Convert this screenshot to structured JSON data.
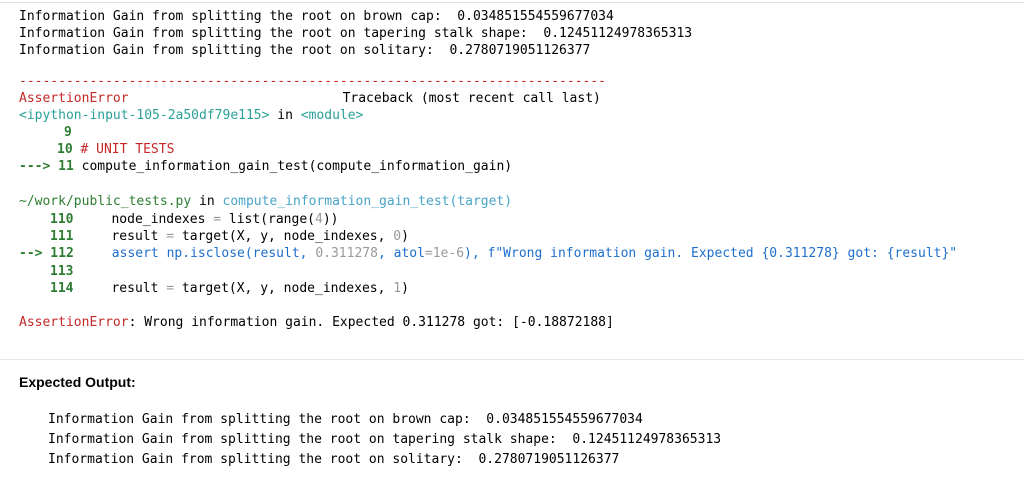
{
  "stdout": [
    "Information Gain from splitting the root on brown cap:  0.034851554559677034",
    "Information Gain from splitting the root on tapering stalk shape:  0.12451124978365313",
    "Information Gain from splitting the root on solitary:  0.2780719051126377"
  ],
  "traceback": {
    "rule": "---------------------------------------------------------------------------",
    "error_name": "AssertionError",
    "header_right": "Traceback (most recent call last)",
    "input_loc": "<ipython-input-105-2a50df79e115>",
    "in_word": " in ",
    "module_word": "<module>",
    "frame1": {
      "l9": "9",
      "l10_num": "10",
      "l10_comment": "# UNIT TESTS",
      "arrow": "---> 11",
      "l11_code": "compute_information_gain_test(compute_information_gain)"
    },
    "file_path": "~/work/public_tests.py",
    "file_in": " in ",
    "func_sig": "compute_information_gain_test(target)",
    "frame2": {
      "n110": "110",
      "c110_a": "node_indexes ",
      "c110_eq": "=",
      "c110_b": " list(range(",
      "c110_num": "4",
      "c110_c": "))",
      "n111": "111",
      "c111_a": "result ",
      "c111_eq": "=",
      "c111_b": " target(X, y, node_indexes, ",
      "c111_num": "0",
      "c111_c": ")",
      "arrow112": "--> 112",
      "c112_assert": "assert",
      "c112_a": " np.isclose(result, ",
      "c112_num": "0.311278",
      "c112_b": ", atol",
      "c112_eq": "=",
      "c112_tol": "1e-6",
      "c112_c": "), ",
      "c112_str": "f\"Wrong information gain. Expected {0.311278} got: {result}\"",
      "n113": "113",
      "n114": "114",
      "c114_a": "result ",
      "c114_eq": "=",
      "c114_b": " target(X, y, node_indexes, ",
      "c114_num": "1",
      "c114_c": ")"
    },
    "final_error": "AssertionError",
    "final_msg": ": Wrong information gain. Expected 0.311278 got: [-0.18872188]"
  },
  "expected": {
    "label": "Expected Output:",
    "lines": [
      "Information Gain from splitting the root on brown cap:  0.034851554559677034",
      "Information Gain from splitting the root on tapering stalk shape:  0.12451124978365313",
      "Information Gain from splitting the root on solitary:  0.2780719051126377"
    ]
  }
}
